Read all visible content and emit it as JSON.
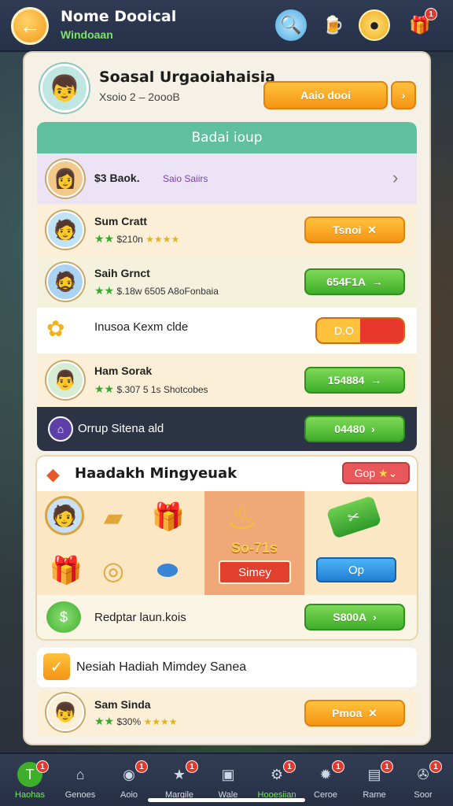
{
  "header": {
    "title": "Nome Dooical",
    "subtitle": "Windoaan"
  },
  "profile": {
    "name": "Soasal Urgaoiahaisia",
    "sub": "Xsoio 2 – 2oooB",
    "button_label": "Aaio dooi"
  },
  "group": {
    "title": "Badai ioup",
    "rows": [
      {
        "name": "$3 Baok.",
        "stats": "Saio Saiirs",
        "button": ""
      },
      {
        "name": "Sum Cratt",
        "stats": "$210n",
        "button": "Tsnoi"
      },
      {
        "name": "Saih Grnct",
        "stats": "$.18w  6505  A8oFonbaia",
        "button": "654F1A"
      },
      {
        "name": "Inusoa Kexm clde",
        "stats": "",
        "button": "D.O"
      },
      {
        "name": "Ham Sorak",
        "stats": "$.307  5 1s  Shotcobes",
        "button": "154884"
      },
      {
        "name": "Orrup Sitena ald",
        "stats": "",
        "button": "04480"
      }
    ]
  },
  "rewards": {
    "title": "Haadakh Mingyeuak",
    "top_button": "Gop",
    "deal_price": "So-71s",
    "deal_ribbon": "Simey",
    "blue_button": "Op",
    "footer_label": "Redptar laun.kois",
    "footer_button": "S800A"
  },
  "section2": {
    "title": "Nesiah Hadiah Mimdey Sanea",
    "row_name": "Sam Sinda",
    "row_stats": "$30%",
    "row_button": "Pmoa"
  },
  "tabs": [
    {
      "label": "Haohas",
      "icon": "target-icon",
      "badge": "1"
    },
    {
      "label": "Genoes",
      "icon": "home-icon",
      "badge": ""
    },
    {
      "label": "Aoio",
      "icon": "globe-icon",
      "badge": "1"
    },
    {
      "label": "Margile",
      "icon": "star-icon",
      "badge": "1"
    },
    {
      "label": "Wale",
      "icon": "box-icon",
      "badge": ""
    },
    {
      "label": "Hooesiian",
      "icon": "gear-icon",
      "badge": "1"
    },
    {
      "label": "Ceroe",
      "icon": "cog-icon",
      "badge": "1"
    },
    {
      "label": "Rame",
      "icon": "camera-icon",
      "badge": "1"
    },
    {
      "label": "Soor",
      "icon": "wheel-icon",
      "badge": "1"
    }
  ],
  "colors": {
    "accent_orange": "#f59414",
    "accent_green": "#3fae2a",
    "group_header": "#5fbf9f",
    "dark_row": "#2c3344"
  }
}
